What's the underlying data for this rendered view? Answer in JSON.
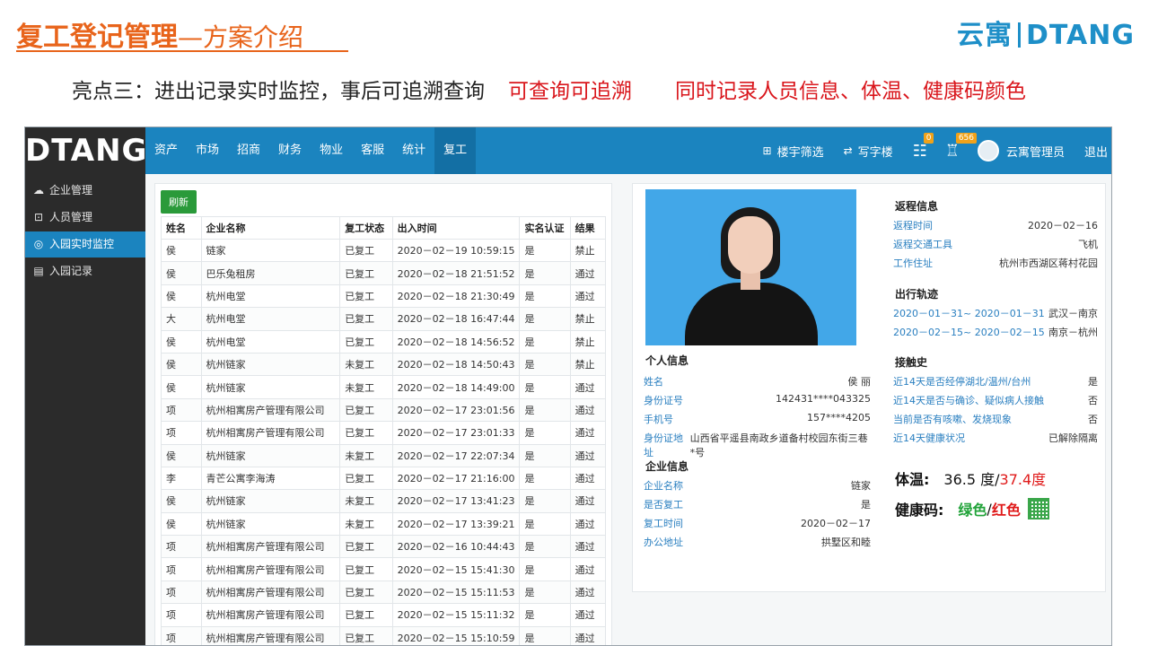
{
  "slide": {
    "title_main": "复工登记管理",
    "title_sub": "—方案介绍",
    "logo_cn": "云寓",
    "logo_en": "DTANG",
    "headline": "亮点三：进出记录实时监控，事后可追溯查询",
    "headline_red1": "可查询可追溯",
    "headline_red2": "同时记录人员信息、体温、健康码颜色"
  },
  "app": {
    "brand": "DTANG",
    "nav": [
      "资产",
      "市场",
      "招商",
      "财务",
      "物业",
      "客服",
      "统计",
      "复工"
    ],
    "nav_active": 7,
    "top_right": {
      "building_filter": "楼宇筛选",
      "write_building": "写字楼",
      "badge1": "0",
      "badge2": "656",
      "user": "云寓管理员",
      "logout": "退出"
    },
    "sidebar": [
      {
        "label": "企业管理",
        "icon": "cloud-icon"
      },
      {
        "label": "人员管理",
        "icon": "person-card-icon"
      },
      {
        "label": "入园实时监控",
        "icon": "location-icon"
      },
      {
        "label": "入园记录",
        "icon": "record-icon"
      }
    ],
    "sidebar_active": 2,
    "refresh_label": "刷新",
    "table": {
      "headers": [
        "姓名",
        "企业名称",
        "复工状态",
        "出入时间",
        "实名认证",
        "结果"
      ],
      "rows": [
        [
          "侯",
          "链家",
          "已复工",
          "2020－02－19 10:59:15",
          "是",
          "禁止"
        ],
        [
          "侯",
          "巴乐兔租房",
          "已复工",
          "2020－02－18 21:51:52",
          "是",
          "通过"
        ],
        [
          "侯",
          "杭州电堂",
          "已复工",
          "2020－02－18 21:30:49",
          "是",
          "通过"
        ],
        [
          "大",
          "杭州电堂",
          "已复工",
          "2020－02－18 16:47:44",
          "是",
          "禁止"
        ],
        [
          "侯",
          "杭州电堂",
          "已复工",
          "2020－02－18 14:56:52",
          "是",
          "禁止"
        ],
        [
          "侯",
          "杭州链家",
          "未复工",
          "2020－02－18 14:50:43",
          "是",
          "禁止"
        ],
        [
          "侯",
          "杭州链家",
          "未复工",
          "2020－02－18 14:49:00",
          "是",
          "通过"
        ],
        [
          "项",
          "杭州相寓房产管理有限公司",
          "已复工",
          "2020－02－17 23:01:56",
          "是",
          "通过"
        ],
        [
          "项",
          "杭州相寓房产管理有限公司",
          "已复工",
          "2020－02－17 23:01:33",
          "是",
          "通过"
        ],
        [
          "侯",
          "杭州链家",
          "未复工",
          "2020－02－17 22:07:34",
          "是",
          "通过"
        ],
        [
          "李",
          "青芒公寓李海涛",
          "已复工",
          "2020－02－17 21:16:00",
          "是",
          "通过"
        ],
        [
          "侯",
          "杭州链家",
          "未复工",
          "2020－02－17 13:41:23",
          "是",
          "通过"
        ],
        [
          "侯",
          "杭州链家",
          "未复工",
          "2020－02－17 13:39:21",
          "是",
          "通过"
        ],
        [
          "项",
          "杭州相寓房产管理有限公司",
          "已复工",
          "2020－02－16 10:44:43",
          "是",
          "通过"
        ],
        [
          "项",
          "杭州相寓房产管理有限公司",
          "已复工",
          "2020－02－15 15:41:30",
          "是",
          "通过"
        ],
        [
          "项",
          "杭州相寓房产管理有限公司",
          "已复工",
          "2020－02－15 15:11:53",
          "是",
          "通过"
        ],
        [
          "项",
          "杭州相寓房产管理有限公司",
          "已复工",
          "2020－02－15 15:11:32",
          "是",
          "通过"
        ],
        [
          "项",
          "杭州相寓房产管理有限公司",
          "已复工",
          "2020－02－15 15:10:59",
          "是",
          "通过"
        ]
      ]
    },
    "detail": {
      "personal": {
        "title": "个人信息",
        "items": [
          {
            "k": "姓名",
            "v": "侯 丽"
          },
          {
            "k": "身份证号",
            "v": "142431****043325"
          },
          {
            "k": "手机号",
            "v": "157****4205"
          },
          {
            "k": "身份证地址",
            "v": "山西省平遥县南政乡道备村校园东街三巷*号"
          }
        ]
      },
      "company": {
        "title": "企业信息",
        "items": [
          {
            "k": "企业名称",
            "v": "链家"
          },
          {
            "k": "是否复工",
            "v": "是"
          },
          {
            "k": "复工时间",
            "v": "2020－02－17"
          },
          {
            "k": "办公地址",
            "v": "拱墅区和睦"
          }
        ]
      },
      "return": {
        "title": "返程信息",
        "items": [
          {
            "k": "返程时间",
            "v": "2020－02－16"
          },
          {
            "k": "返程交通工具",
            "v": "飞机"
          },
          {
            "k": "工作住址",
            "v": "杭州市西湖区蒋村花园"
          }
        ]
      },
      "track": {
        "title": "出行轨迹",
        "items": [
          {
            "k": "2020－01－31~ 2020－01－31",
            "v": "武汉－南京"
          },
          {
            "k": "2020－02－15~ 2020－02－15",
            "v": "南京－杭州"
          }
        ]
      },
      "contact": {
        "title": "接触史",
        "items": [
          {
            "k": "近14天是否经停湖北/温州/台州",
            "v": "是"
          },
          {
            "k": "近14天是否与确诊、疑似病人接触",
            "v": "否"
          },
          {
            "k": "当前是否有咳嗽、发烧现象",
            "v": "否"
          },
          {
            "k": "近14天健康状况",
            "v": "已解除隔离"
          }
        ]
      },
      "temperature_label": "体温:",
      "temperature_value": "36.5 度/",
      "temperature_value_red": "37.4度",
      "health_label": "健康码:",
      "health_green": "绿色",
      "health_sep": "/",
      "health_red": "红色"
    }
  }
}
